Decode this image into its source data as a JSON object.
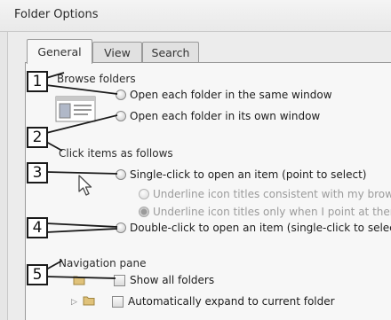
{
  "window": {
    "title": "Folder Options"
  },
  "tabs": [
    {
      "label": "General",
      "active": true
    },
    {
      "label": "View",
      "active": false
    },
    {
      "label": "Search",
      "active": false
    }
  ],
  "browse": {
    "label": "Browse folders",
    "options": [
      {
        "label": "Open each folder in the same window",
        "selected": false
      },
      {
        "label": "Open each folder in its own window",
        "selected": false
      }
    ]
  },
  "click_items": {
    "label": "Click items as follows",
    "single_click": {
      "label": "Single-click to open an item (point to select)",
      "selected": false
    },
    "underline_options": [
      {
        "label": "Underline icon titles consistent with my browser",
        "enabled": false
      },
      {
        "label": "Underline icon titles only when I point at them",
        "enabled": false
      }
    ],
    "double_click": {
      "label": "Double-click to open an item (single-click to select)",
      "selected": false
    }
  },
  "navigation": {
    "label": "Navigation pane",
    "items": [
      {
        "label": "Show all folders",
        "checked": false
      },
      {
        "label": "Automatically expand to current folder",
        "checked": false
      }
    ]
  },
  "callouts": [
    "1",
    "2",
    "3",
    "4",
    "5"
  ]
}
